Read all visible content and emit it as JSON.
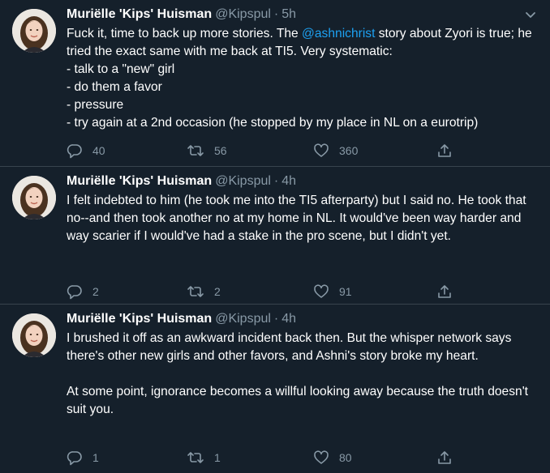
{
  "tweets": [
    {
      "name": "Muriëlle 'Kips' Huisman",
      "handle": "@Kipspul",
      "separator": "·",
      "time": "5h",
      "text_before_mention": "Fuck it, time to back up more stories. The ",
      "mention": "@ashnichrist",
      "text_after_mention": " story about Zyori is true; he tried the exact same with me back at TI5. Very systematic:",
      "lines": [
        "- talk to a \"new\" girl",
        "- do them a favor",
        "- pressure",
        "- try again at a 2nd occasion (he stopped by my place in NL on a eurotrip)"
      ],
      "replies": "40",
      "retweets": "56",
      "likes": "360"
    },
    {
      "name": "Muriëlle 'Kips' Huisman",
      "handle": "@Kipspul",
      "separator": "·",
      "time": "4h",
      "paragraphs": [
        "I felt indebted to him (he took me into the TI5 afterparty) but I said no. He took that no--and then took another no at my home in NL. It would've been way harder and way scarier if I would've had a stake in the pro scene, but I didn't yet."
      ],
      "replies": "2",
      "retweets": "2",
      "likes": "91"
    },
    {
      "name": "Muriëlle 'Kips' Huisman",
      "handle": "@Kipspul",
      "separator": "·",
      "time": "4h",
      "paragraphs": [
        "I brushed it off as an awkward incident back then. But the whisper network says there's other new girls and other favors, and Ashni's story broke my heart.",
        "At some point, ignorance becomes a willful looking away because the truth doesn't suit you."
      ],
      "replies": "1",
      "retweets": "1",
      "likes": "80"
    }
  ],
  "icons": {
    "more": "chevron-down-icon",
    "reply": "reply-icon",
    "retweet": "retweet-icon",
    "like": "heart-icon",
    "share": "share-icon"
  },
  "colors": {
    "background": "#15202b",
    "text": "#ffffff",
    "secondary": "#8899a6",
    "link": "#1da1f2",
    "divider": "#38444d"
  }
}
